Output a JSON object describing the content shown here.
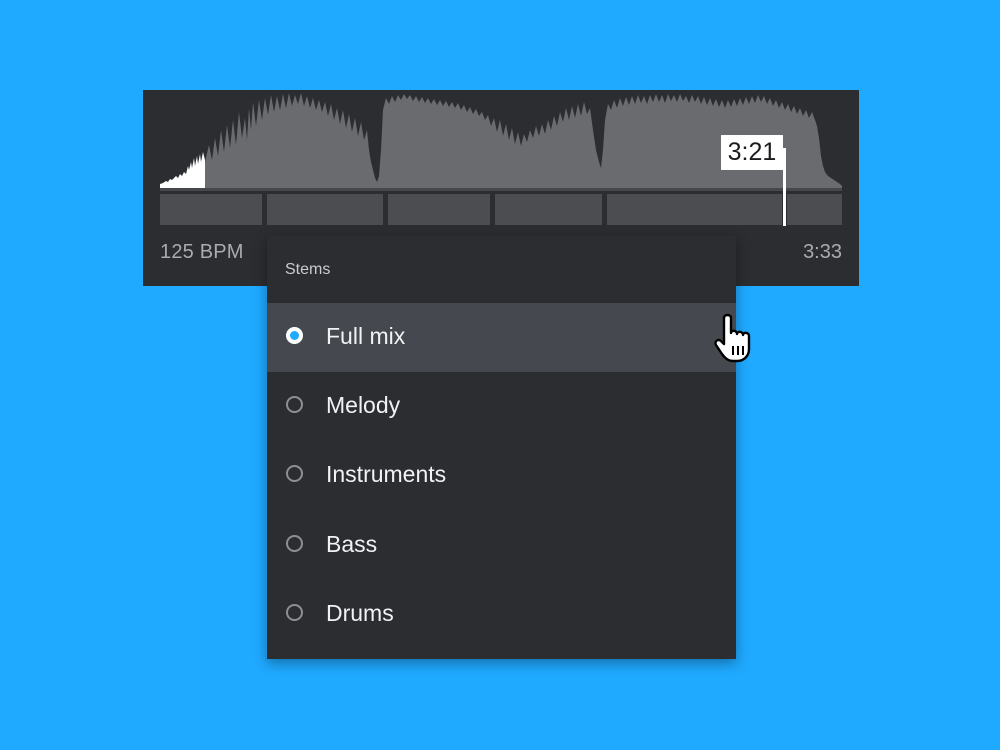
{
  "player": {
    "bpm": "125 BPM",
    "duration": "3:33",
    "playhead_time": "3:21"
  },
  "stems_menu": {
    "title": "Stems",
    "options": [
      {
        "label": "Full mix",
        "selected": true
      },
      {
        "label": "Melody",
        "selected": false
      },
      {
        "label": "Instruments",
        "selected": false
      },
      {
        "label": "Bass",
        "selected": false
      },
      {
        "label": "Drums",
        "selected": false
      }
    ]
  },
  "colors": {
    "background": "#1fa9ff",
    "panel": "#2b2d31",
    "waveform": "#696b6f",
    "played_waveform": "#ffffff",
    "selected_row": "#45484e",
    "radio_accent": "#1fa9ff"
  },
  "icons": {
    "cursor": "hand-pointer-icon"
  }
}
